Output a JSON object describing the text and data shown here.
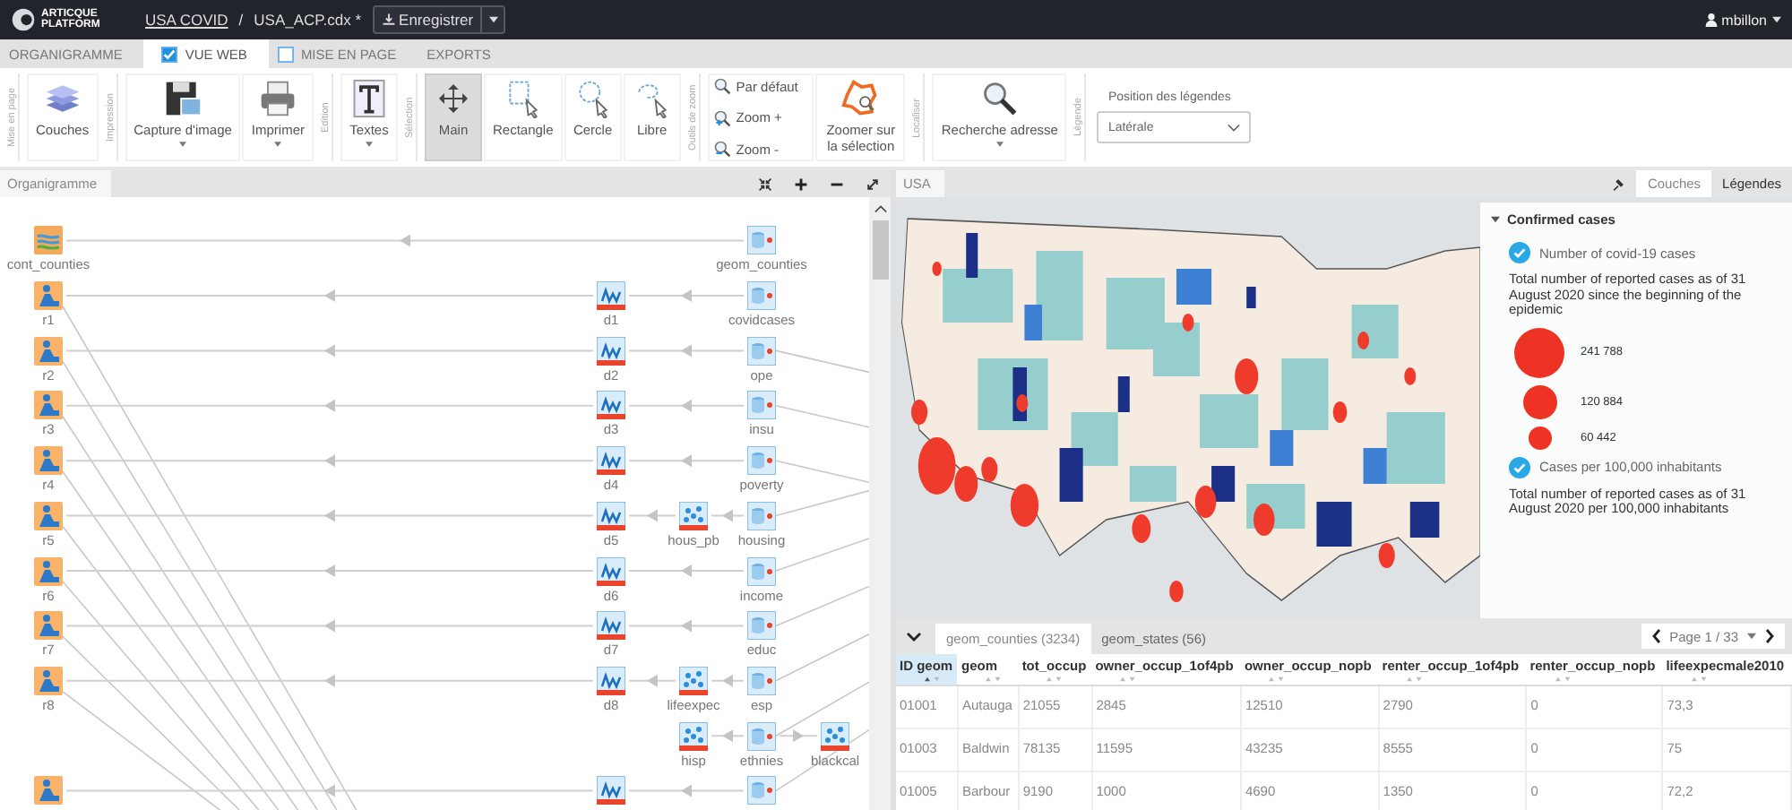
{
  "topbar": {
    "logo": "ARTICQUE PLATFORM",
    "project": "USA COVID",
    "separator": "/",
    "file": "USA_ACP.cdx *",
    "save": "Enregistrer",
    "user": "mbillon"
  },
  "tabs": [
    {
      "label": "ORGANIGRAMME",
      "selected": false
    },
    {
      "label": "VUE WEB",
      "selected": true,
      "checked": true
    },
    {
      "label": "MISE EN PAGE",
      "selected": false,
      "checked": false
    },
    {
      "label": "EXPORTS",
      "selected": false
    }
  ],
  "ribbon": [
    {
      "group": "Mise en page",
      "buttons": [
        {
          "label": "Couches",
          "dropdown": false,
          "selected": false
        }
      ]
    },
    {
      "group": "Impression",
      "buttons": [
        {
          "label": "Capture d'image",
          "dropdown": true,
          "selected": false
        },
        {
          "label": "Imprimer",
          "dropdown": true,
          "selected": false
        }
      ]
    },
    {
      "group": "Edition",
      "buttons": [
        {
          "label": "Textes",
          "dropdown": true,
          "selected": false
        }
      ]
    },
    {
      "group": "Sélection",
      "buttons": [
        {
          "label": "Main",
          "dropdown": false,
          "selected": true
        },
        {
          "label": "Rectangle",
          "dropdown": false,
          "selected": false
        },
        {
          "label": "Cercle",
          "dropdown": false,
          "selected": false
        },
        {
          "label": "Libre",
          "dropdown": false,
          "selected": false
        }
      ]
    },
    {
      "group": "Outils de zoom",
      "small_buttons": [
        "Par défaut",
        "Zoom +",
        "Zoom -"
      ],
      "buttons": [
        {
          "label": "Zoomer sur la sélection",
          "selected": false
        }
      ]
    },
    {
      "group": "Localiser",
      "buttons": [
        {
          "label": "Recherche adresse",
          "dropdown": true,
          "selected": false
        }
      ]
    },
    {
      "group": "Légende",
      "select": {
        "label": "Position des légendes",
        "value": "Latérale"
      }
    }
  ],
  "diagram": {
    "title": "Organigramme",
    "rows": [
      {
        "output": {
          "kind": "layer",
          "label": "cont_counties"
        },
        "source": {
          "kind": "data",
          "label": "geom_counties"
        }
      },
      {
        "output": {
          "kind": "render",
          "label": "r1"
        },
        "analysis": {
          "kind": "analysis",
          "label": "d1"
        },
        "source": {
          "kind": "data",
          "label": "covidcases"
        }
      },
      {
        "output": {
          "kind": "render",
          "label": "r2"
        },
        "analysis": {
          "kind": "analysis",
          "label": "d2"
        },
        "source": {
          "kind": "data",
          "label": "ope"
        }
      },
      {
        "output": {
          "kind": "render",
          "label": "r3"
        },
        "analysis": {
          "kind": "analysis",
          "label": "d3"
        },
        "source": {
          "kind": "data",
          "label": "insu"
        }
      },
      {
        "output": {
          "kind": "render",
          "label": "r4"
        },
        "analysis": {
          "kind": "analysis",
          "label": "d4"
        },
        "source": {
          "kind": "data",
          "label": "poverty"
        }
      },
      {
        "output": {
          "kind": "render",
          "label": "r5"
        },
        "analysis": {
          "kind": "analysis",
          "label": "d5"
        },
        "process": {
          "kind": "process",
          "label": "hous_pb"
        },
        "source": {
          "kind": "data",
          "label": "housing"
        }
      },
      {
        "output": {
          "kind": "render",
          "label": "r6"
        },
        "analysis": {
          "kind": "analysis",
          "label": "d6"
        },
        "source": {
          "kind": "data",
          "label": "income"
        }
      },
      {
        "output": {
          "kind": "render",
          "label": "r7"
        },
        "analysis": {
          "kind": "analysis",
          "label": "d7"
        },
        "source": {
          "kind": "data",
          "label": "educ"
        }
      },
      {
        "output": {
          "kind": "render",
          "label": "r8"
        },
        "analysis": {
          "kind": "analysis",
          "label": "d8"
        },
        "process": {
          "kind": "process",
          "label": "lifeexpec"
        },
        "source": {
          "kind": "data",
          "label": "esp"
        }
      },
      {
        "process": {
          "kind": "process",
          "label": "hisp"
        },
        "source": {
          "kind": "data",
          "label": "ethnies"
        },
        "extra": {
          "kind": "process",
          "label": "blackcal"
        }
      },
      {
        "output": {
          "kind": "render"
        },
        "analysis": {
          "kind": "analysis"
        },
        "source": {
          "kind": "data"
        }
      }
    ]
  },
  "map": {
    "title": "USA",
    "panel_tabs": [
      {
        "label": "Couches",
        "selected": true
      },
      {
        "label": "Légendes",
        "selected": false
      }
    ],
    "legend": {
      "title": "Confirmed cases",
      "expanded": true,
      "items": [
        {
          "label": "Number of covid-19 cases",
          "checked": true,
          "description": "Total number of reported cases as of 31 August 2020 since the beginning of the epidemic",
          "circles": [
            "241 788",
            "120 884",
            "60 442"
          ]
        },
        {
          "label": "Cases per 100,000 inhabitants",
          "checked": true,
          "description": "Total number of reported cases as of 31 August 2020 per 100,000 inhabitants"
        }
      ]
    }
  },
  "table": {
    "tabs": [
      {
        "label": "geom_counties (3234)",
        "selected": true
      },
      {
        "label": "geom_states (56)",
        "selected": false
      }
    ],
    "pager": "Page 1 / 33",
    "columns": [
      {
        "label": "ID geom",
        "sorted": true
      },
      {
        "label": "geom",
        "sorted": false
      },
      {
        "label": "tot_occup",
        "sorted": false
      },
      {
        "label": "owner_occup_1of4pb",
        "sorted": false
      },
      {
        "label": "owner_occup_nopb",
        "sorted": false
      },
      {
        "label": "renter_occup_1of4pb",
        "sorted": false
      },
      {
        "label": "renter_occup_nopb",
        "sorted": false
      },
      {
        "label": "lifeexpecmale2010",
        "sorted": false
      }
    ],
    "rows": [
      [
        "01001",
        "Autauga",
        "21055",
        "2845",
        "12510",
        "2790",
        "0",
        "73,3"
      ],
      [
        "01003",
        "Baldwin",
        "78135",
        "11595",
        "43235",
        "8555",
        "0",
        "75"
      ],
      [
        "01005",
        "Barbour",
        "9190",
        "1000",
        "4690",
        "1350",
        "0",
        "72,2"
      ]
    ]
  }
}
